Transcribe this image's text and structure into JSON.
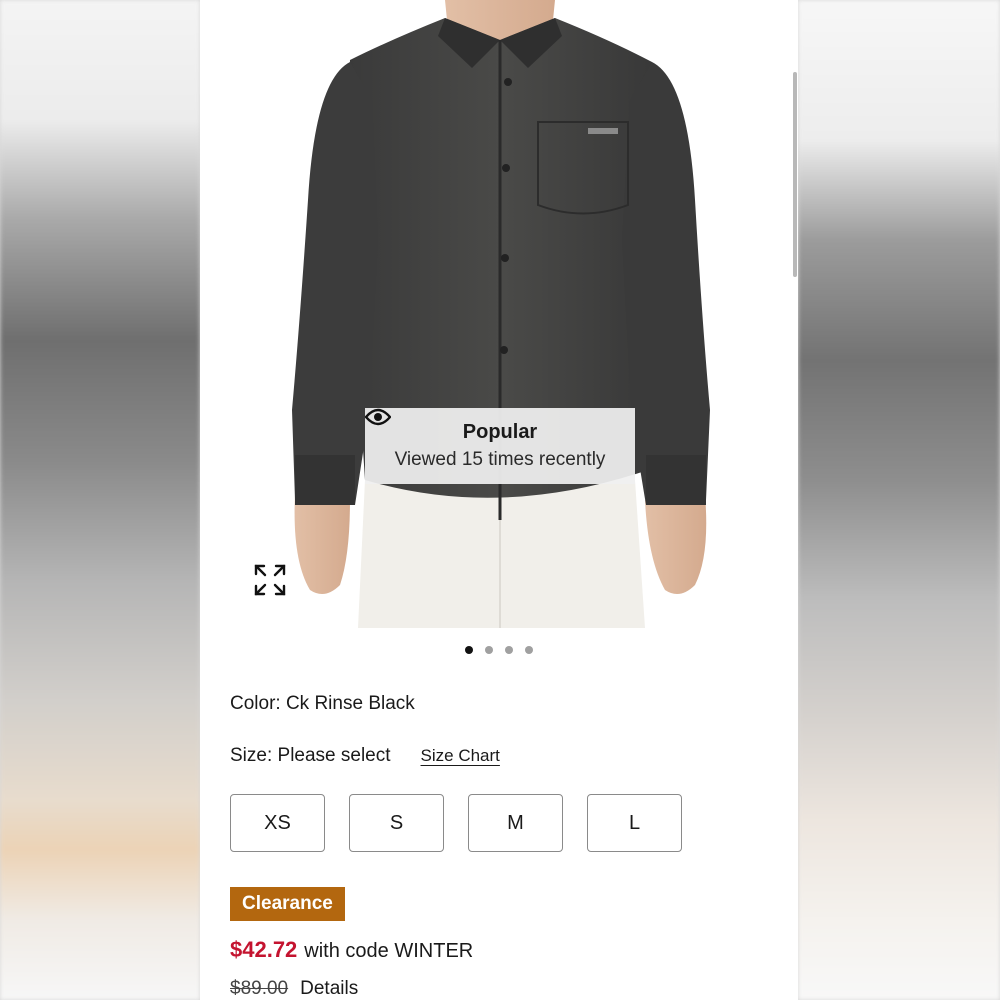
{
  "product": {
    "image_alt": "Ck Rinse Black denim shirt",
    "carousel": {
      "total": 4,
      "active_index": 0
    }
  },
  "popular_badge": {
    "icon": "eye-icon",
    "title": "Popular",
    "subtitle": "Viewed 15 times recently"
  },
  "expand_icon": "expand-icon",
  "color": {
    "label": "Color: Ck Rinse Black"
  },
  "size": {
    "label": "Size: Please select",
    "chart_link": "Size Chart",
    "options": [
      "XS",
      "S",
      "M",
      "L"
    ]
  },
  "pricing": {
    "badge": "Clearance",
    "badge_color": "#b3670f",
    "sale_price": "$42.72",
    "sale_color": "#c4132f",
    "promo_text": "with code WINTER",
    "original_price": "$89.00",
    "details_link": "Details"
  }
}
